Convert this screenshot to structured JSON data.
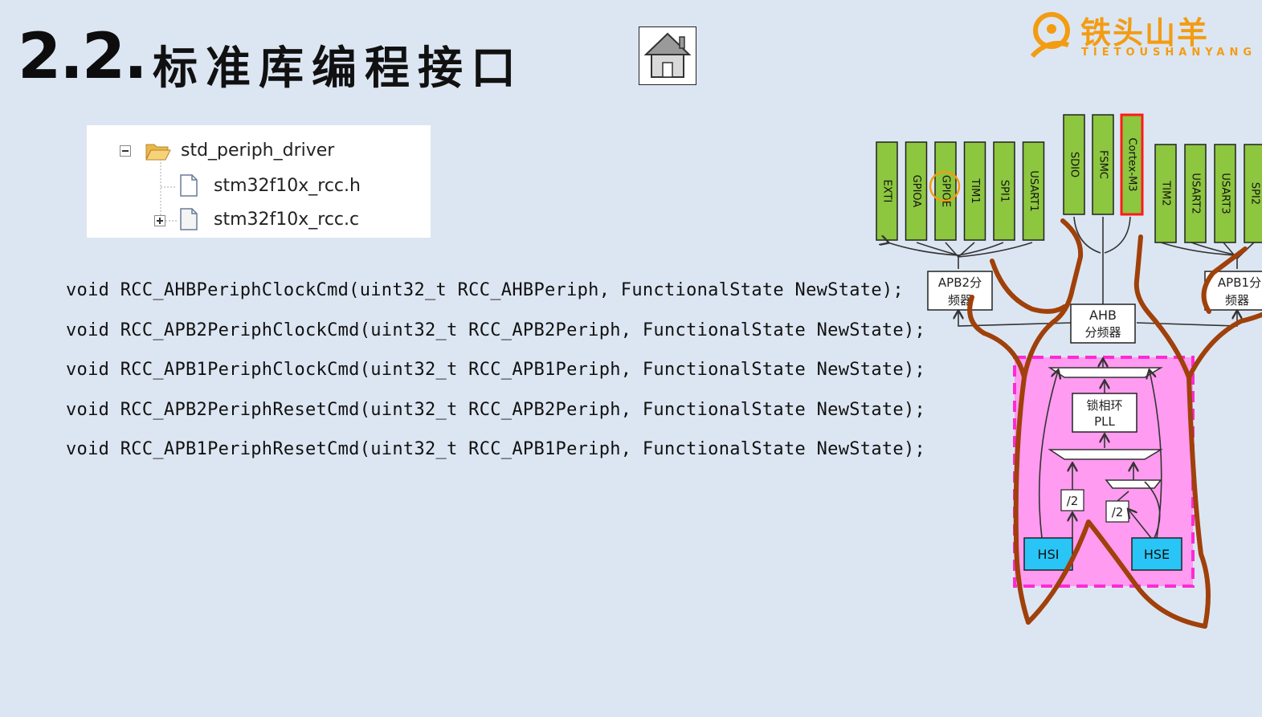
{
  "slide": {
    "title_number": "2.2.",
    "title_text": "标准库编程接口"
  },
  "logo": {
    "name": "铁头山羊",
    "subtitle": "TIETOUSHANYANG"
  },
  "file_tree": {
    "folder": "std_periph_driver",
    "files": [
      "stm32f10x_rcc.h",
      "stm32f10x_rcc.c"
    ]
  },
  "code_lines": [
    "void RCC_AHBPeriphClockCmd(uint32_t RCC_AHBPeriph, FunctionalState NewState);",
    "void RCC_APB2PeriphClockCmd(uint32_t RCC_APB2Periph, FunctionalState NewState);",
    "void RCC_APB1PeriphClockCmd(uint32_t RCC_APB1Periph, FunctionalState NewState);",
    "void RCC_APB2PeriphResetCmd(uint32_t RCC_APB2Periph, FunctionalState NewState);",
    "void RCC_APB1PeriphResetCmd(uint32_t RCC_APB1Periph, FunctionalState NewState);"
  ],
  "diagram": {
    "apb2_peripherals": [
      "EXTI",
      "GPIOA",
      "GPIOE",
      "TIM1",
      "SPI1",
      "USART1"
    ],
    "ahb_peripherals": [
      "SDIO",
      "FSMC",
      "Cortex-M3"
    ],
    "apb1_peripherals": [
      "TIM2",
      "USART2",
      "USART3",
      "SPI2"
    ],
    "apb2_divider": "APB2分频器",
    "apb1_divider": "APB1分频器",
    "apb2_label_visible": "APB2分",
    "apb1_label_visible": "APB1分",
    "divider_suffix": "频器",
    "ahb_label": "AHB",
    "ahb_sub": "分频器",
    "pll_label": "锁相环",
    "pll_sub": "PLL",
    "div2_label": "/2",
    "hsi_label": "HSI",
    "hse_label": "HSE",
    "colors": {
      "peripheral_green": "#8dc63f",
      "clock_blue": "#29c5f6",
      "pll_region_pink": "#ff9bf0",
      "dash_magenta": "#ff2ad4",
      "annotation_brown": "#a0400a",
      "highlight_red": "#ff1a1a"
    }
  }
}
